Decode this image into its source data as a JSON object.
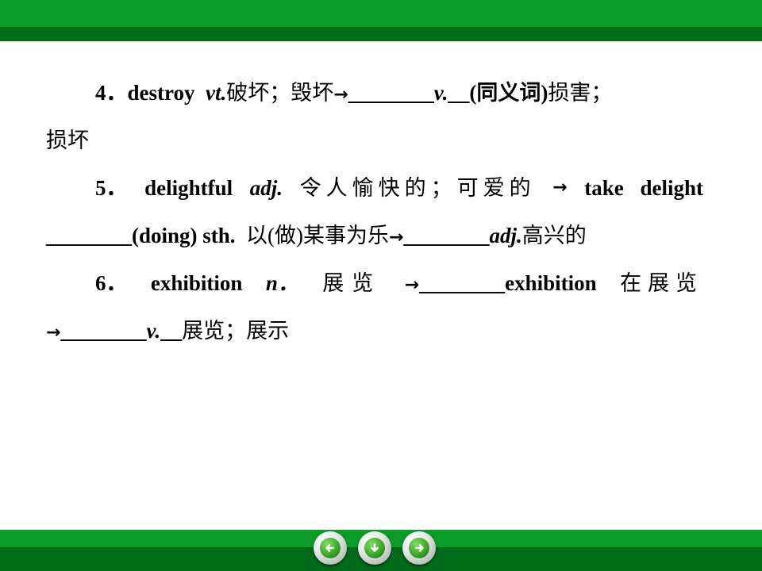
{
  "items": {
    "item4": {
      "number": "4．",
      "word": "destroy",
      "pos": "vt.",
      "meaning": "破坏；毁坏",
      "arrow": "→",
      "blank": "________",
      "pos2": "v.",
      "pos2_blank": "__",
      "note": "(同义词)",
      "meaning2a": "损害；",
      "meaning2b": "损坏"
    },
    "item5": {
      "number": "5．",
      "word": "delightful",
      "pos": "adj.",
      "meaning": "令人愉快的；可爱的",
      "arrow": "→",
      "phrase": "take delight",
      "blank1": "________",
      "phrase2": "(doing) sth.",
      "meaning2": "以(做)某事为乐",
      "arrow2": "→",
      "blank2": "________",
      "pos2": "adj.",
      "meaning3": "高兴的"
    },
    "item6": {
      "number": "6．",
      "word": "exhibition",
      "pos": "n．",
      "meaning": "展览",
      "arrow": "→",
      "blank1": "________",
      "phrase": "exhibition",
      "meaning2": "在展览",
      "arrow2": "→",
      "blank2": "________",
      "pos2": "v.",
      "pos2_blank": "__",
      "meaning3": "展览；展示"
    }
  },
  "nav": {
    "prev_icon": "arrow-left-icon",
    "down_icon": "arrow-down-icon",
    "next_icon": "arrow-right-icon"
  },
  "colors": {
    "bar_light": "#0a9b2a",
    "bar_dark": "#006b18",
    "button_green": "#2b9a1c"
  }
}
